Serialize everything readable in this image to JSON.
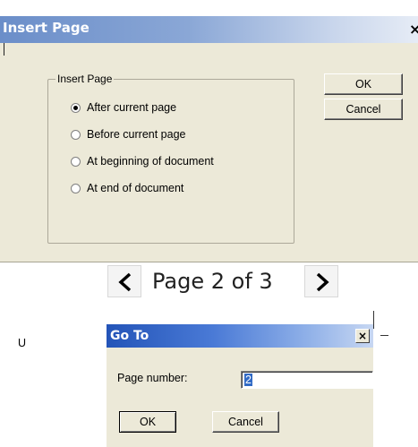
{
  "insert_dialog": {
    "title": "Insert Page",
    "close_glyph": "×",
    "group_label": "Insert Page",
    "options": [
      {
        "label": "After current page",
        "selected": true
      },
      {
        "label": "Before current page",
        "selected": false
      },
      {
        "label": "At beginning of document",
        "selected": false
      },
      {
        "label": "At end of document",
        "selected": false
      }
    ],
    "ok_label": "OK",
    "cancel_label": "Cancel"
  },
  "navigator": {
    "prev_icon": "chevron-left-icon",
    "next_icon": "chevron-right-icon",
    "page_label": "Page 2 of 3"
  },
  "stray_text": "U",
  "goto_dialog": {
    "title": "Go To",
    "close_glyph": "×",
    "page_number_label": "Page number:",
    "page_number_value": "2",
    "ok_label": "OK",
    "cancel_label": "Cancel"
  },
  "colors": {
    "dialog_face": "#ece9d8",
    "insert_title_gradient_start": "#6b8ec9",
    "goto_title_gradient_start": "#2354b8",
    "selection": "#316ac5"
  }
}
